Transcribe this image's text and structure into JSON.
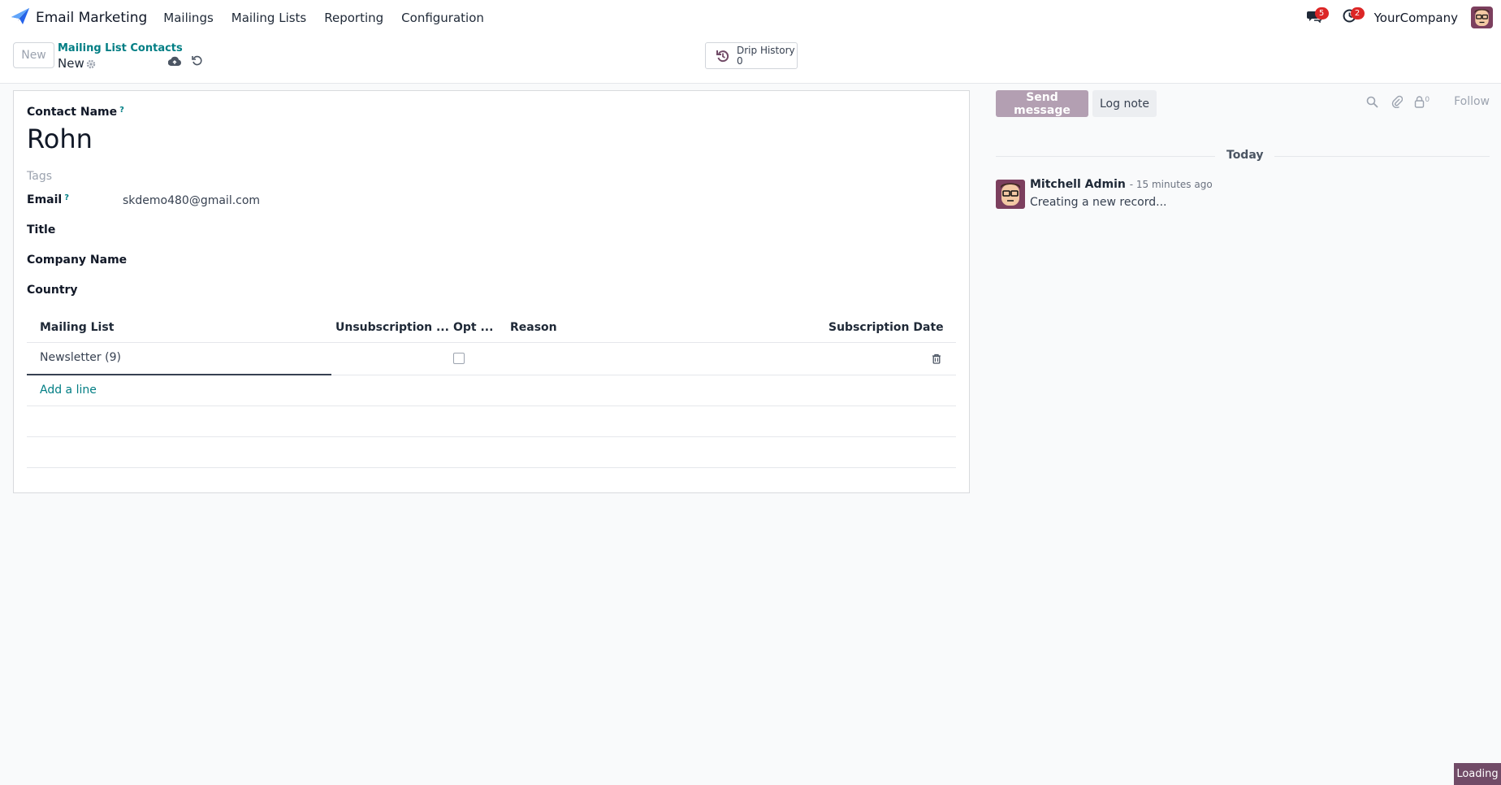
{
  "navbar": {
    "app_name": "Email Marketing",
    "menu": [
      "Mailings",
      "Mailing Lists",
      "Reporting",
      "Configuration"
    ],
    "messages_badge": "5",
    "activities_badge": "2",
    "company": "YourCompany"
  },
  "control": {
    "new_label": "New",
    "breadcrumb": "Mailing List Contacts",
    "record_title": "New",
    "drip_label": "Drip History",
    "drip_count": "0"
  },
  "form": {
    "contact_name_label": "Contact Name",
    "help_mark": "?",
    "contact_name": "Rohn",
    "tags_placeholder": "Tags",
    "email_label": "Email",
    "email_value": "skdemo480@gmail.com",
    "title_label": "Title",
    "company_label": "Company Name",
    "country_label": "Country"
  },
  "table": {
    "headers": [
      "Mailing List",
      "Unsubscription ...",
      "Opt ...",
      "Reason",
      "Subscription Date"
    ],
    "rows": [
      {
        "mailing_list": "Newsletter (9)",
        "opt_out": false
      }
    ],
    "add_line": "Add a line"
  },
  "chatter": {
    "send_message": "Send message",
    "log_note": "Log note",
    "followers_count": "0",
    "follow": "Follow",
    "date_separator": "Today",
    "message": {
      "author": "Mitchell Admin",
      "time": "- 15 minutes ago",
      "body": "Creating a new record..."
    }
  },
  "status": {
    "loading": "Loading"
  },
  "colors": {
    "accent": "#017e84",
    "brand": "#714b67",
    "badge": "#dc2626"
  }
}
